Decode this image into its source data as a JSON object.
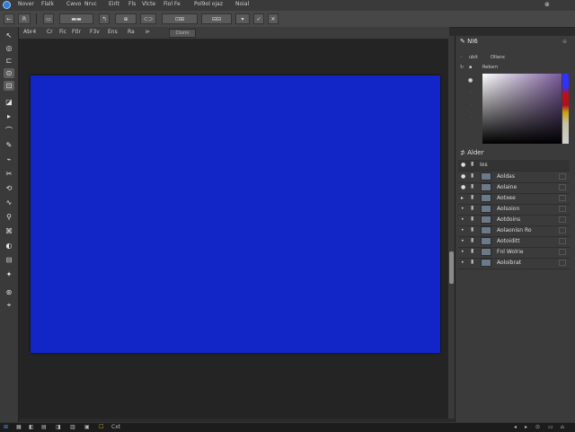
{
  "menubar": {
    "items": [
      "Nover",
      "Flalk",
      "Cwvo",
      "Nrvc",
      "Eirlt",
      "Fls",
      "Vlcte",
      "Fiol Fe",
      "Pol9ol ojaz",
      "Noial"
    ]
  },
  "toolbar": {
    "buttons": [
      "←",
      "R",
      "▭",
      "▬▬",
      "↰",
      "⊕",
      "⊂⊃",
      "⊡⊞",
      "⊟⊟",
      "▾",
      "✓",
      "✕"
    ]
  },
  "options": {
    "items": [
      "Abr4",
      "Cr",
      "Fic",
      "Ftlr",
      "F3v",
      "Ens",
      "Ra",
      "⊳"
    ],
    "field_value": "Ctorin"
  },
  "tools": [
    "↖",
    "◎",
    "⊏",
    "⊙",
    "⊡",
    "◪",
    "▸",
    "⌒",
    "✎",
    "⌁",
    "✂",
    "⟲",
    "∿",
    "⚲",
    "⌘",
    "◐",
    "⊟",
    "✦",
    "⊛",
    "⌖"
  ],
  "color_panel": {
    "title": "NI6",
    "row1_a": "ubit",
    "row1_b": "Ollanx",
    "row2": "Rebsrn"
  },
  "layers_panel": {
    "title": "Alder",
    "header": "Ios",
    "layers": [
      {
        "name": "Aoldas"
      },
      {
        "name": "Aolaine"
      },
      {
        "name": "Aotxee"
      },
      {
        "name": "Aolsoion"
      },
      {
        "name": "Aotdoins"
      },
      {
        "name": "Aolaonisn Ro"
      },
      {
        "name": "Aotoiditt"
      },
      {
        "name": "Fnl Wolrie"
      },
      {
        "name": "Aoloibrat"
      }
    ]
  },
  "taskbar": {
    "items": [
      "⊞",
      "▦",
      "◧",
      "▤",
      "◨",
      "▥",
      "▣",
      "☐",
      "Cxt"
    ],
    "tray": [
      "◂",
      "▸",
      "⊙",
      "▭",
      "⌂"
    ]
  },
  "colors": {
    "canvas": "#1226c8",
    "workspace": "#242424",
    "panel": "#3b3b3b",
    "accent": "#2d7fd9"
  }
}
